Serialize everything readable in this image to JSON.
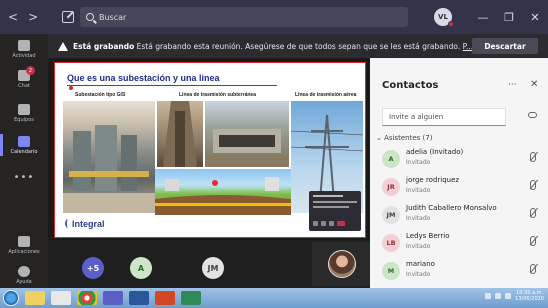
{
  "titlebar": {
    "search_placeholder": "Buscar",
    "user_initials": "VL",
    "back_glyph": "<",
    "forward_glyph": ">",
    "more_glyph": "•••",
    "minimize_glyph": "—",
    "maximize_glyph": "❐",
    "close_glyph": "✕"
  },
  "rail": {
    "items": [
      {
        "label": "Actividad",
        "icon": "bell-icon"
      },
      {
        "label": "Chat",
        "icon": "chat-icon",
        "badge": "2"
      },
      {
        "label": "Equipos",
        "icon": "teams-icon"
      },
      {
        "label": "Calendario",
        "icon": "calendar-icon"
      },
      {
        "label": "Aplicaciones",
        "icon": "apps-icon"
      },
      {
        "label": "Ayuda",
        "icon": "help-icon"
      }
    ],
    "more": "•••"
  },
  "banner": {
    "bold": "Está grabando",
    "text": " Está grabando esta reunión. Asegúrese de que todos sepan que se les está grabando. ",
    "more_link": "P...",
    "stop_label": "Descartar"
  },
  "slide": {
    "title": "Que es una subestación y una linea",
    "captions": [
      "Subestación tipo GIS",
      "Línea de trasmisión subterránea",
      "Línea de trasmisión aérea"
    ],
    "logo": "Integral"
  },
  "strip": {
    "overflow": "+5",
    "p1": "A",
    "p2": "JM"
  },
  "panel": {
    "title": "Contactos",
    "more": "···",
    "close": "✕",
    "invite_placeholder": "Invite a alguien",
    "attendees_label": "Asistentes (7)",
    "participants": [
      {
        "initials": "A",
        "name": "adelia (Invitado)",
        "status": "Invitado",
        "bg": "#cde6c8",
        "fg": "#2f6b2a"
      },
      {
        "initials": "JR",
        "name": "jorge rodriquez",
        "status": "Invitado",
        "bg": "#f3d0d6",
        "fg": "#9b2c3a"
      },
      {
        "initials": "JM",
        "name": "Judith Caballero Monsalvo",
        "status": "Invitado",
        "bg": "#e3e3e3",
        "fg": "#444444"
      },
      {
        "initials": "LB",
        "name": "Ledys Berrio",
        "status": "Invitado",
        "bg": "#f3d0d6",
        "fg": "#9b2c3a"
      },
      {
        "initials": "M",
        "name": "mariano",
        "status": "Invitado",
        "bg": "#cde6c8",
        "fg": "#2f6b2a"
      }
    ]
  },
  "taskbar": {
    "time": "10:35 a.m.",
    "date": "13/06/2020"
  },
  "colors": {
    "accent": "#7f85f5",
    "recording": "#c4314b",
    "titlebar": "#33344a"
  }
}
